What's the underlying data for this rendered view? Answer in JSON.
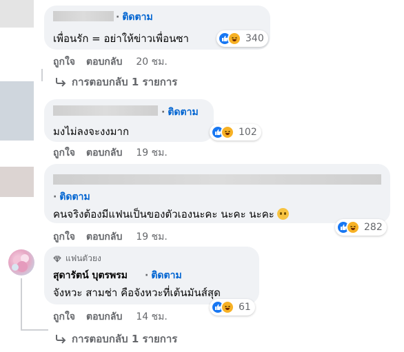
{
  "comments": [
    {
      "follow": "ติดตาม",
      "text": "เพื่อนรัก = อย่าให้ข่าวเพื่อนซา",
      "reaction_count": "340",
      "like": "ถูกใจ",
      "reply": "ตอบกลับ",
      "time": "20 ชม.",
      "replies_link": "การตอบกลับ 1 รายการ"
    },
    {
      "follow": "ติดตาม",
      "text": "มงไม่ลงจะงงมาก",
      "reaction_count": "102",
      "like": "ถูกใจ",
      "reply": "ตอบกลับ",
      "time": "19 ชม."
    },
    {
      "follow": "ติดตาม",
      "text": "คนจริงต้องมีแฟนเป็นของตัวเองนะคะ นะคะ นะคะ",
      "reaction_count": "282",
      "like": "ถูกใจ",
      "reply": "ตอบกลับ",
      "time": "19 ชม."
    },
    {
      "badge": "แฟนตัวยง",
      "name": "สุดารัตน์ บุตรพรม",
      "follow": "ติดตาม",
      "text": "จังหวะ สามช่า คือจังหวะที่เต้นมันส์สุด",
      "reaction_count": "61",
      "like": "ถูกใจ",
      "reply": "ตอบกลับ",
      "time": "14 ชม.",
      "replies_link": "การตอบกลับ 1 รายการ"
    }
  ],
  "colors": {
    "bubble": "#f0f2f5",
    "link": "#0064d1",
    "meta": "#65676b",
    "like_blue": "#1877f2",
    "haha_yellow": "#f7b125"
  }
}
